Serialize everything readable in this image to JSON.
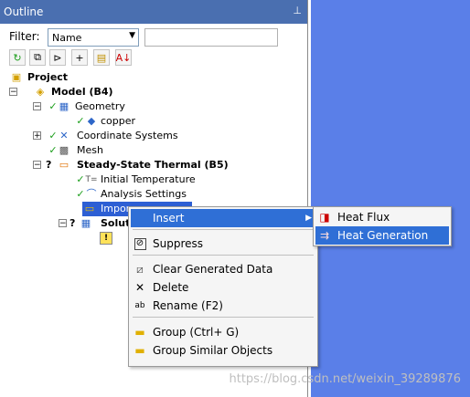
{
  "panel": {
    "title": "Outline",
    "pin_icon": "pin-icon"
  },
  "filter": {
    "label": "Filter:",
    "selected": "Name",
    "search_value": ""
  },
  "toolbar": {
    "icons": [
      "refresh-icon",
      "expand-icon",
      "tree-icon",
      "add-icon",
      "folder-icon",
      "sort-icon"
    ]
  },
  "tree": {
    "project": "Project",
    "model": "Model (B4)",
    "geometry": "Geometry",
    "copper": "copper",
    "coordinate_systems": "Coordinate Systems",
    "mesh": "Mesh",
    "thermal": "Steady-State Thermal (B5)",
    "initial_temperature": "Initial Temperature",
    "analysis_settings": "Analysis Settings",
    "imported_load": "Impor",
    "solution": "Solut",
    "question": "?"
  },
  "context_menu": {
    "insert": "Insert",
    "suppress": "Suppress",
    "clear_generated_data": "Clear Generated Data",
    "delete": "Delete",
    "rename": "Rename (F2)",
    "group": "Group (Ctrl+ G)",
    "group_similar": "Group Similar Objects",
    "submenu_arrow": "▶"
  },
  "submenu": {
    "heat_flux": "Heat Flux",
    "heat_generation": "Heat Generation"
  },
  "watermark": "https://blog.csdn.net/weixin_39289876",
  "colors": {
    "title_bar": "#4a6fb0",
    "highlight": "#2f6fd6",
    "canvas": "#5a7fe8",
    "check": "#1b9e1b"
  }
}
